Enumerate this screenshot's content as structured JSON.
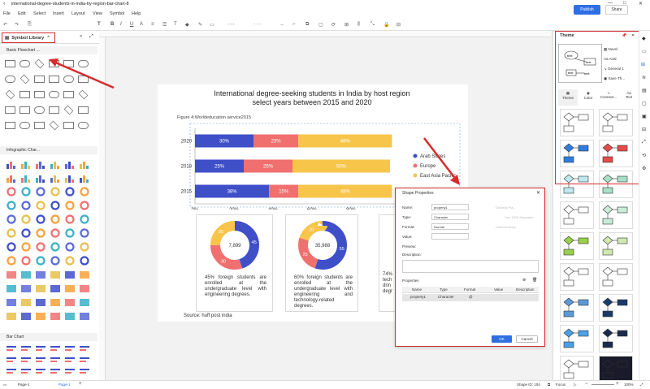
{
  "window": {
    "title": "international-degree-students-in-india-by-region-bar-chart-8"
  },
  "menu": [
    "File",
    "Edit",
    "Select",
    "Insert",
    "Layout",
    "View",
    "Symbol",
    "Help"
  ],
  "toolbar": {
    "publish": "Publish",
    "share": "Share"
  },
  "left_panel": {
    "title": "Symbol Library",
    "sections": [
      "Basic Flowchart ...",
      "Infographic Char...",
      "Bar Chart"
    ]
  },
  "chart": {
    "title_line1": "International degree-seeking students in India by host region",
    "title_line2": "select years between 2015 and 2020",
    "figure_label": "Figure 4:Worldeducation service2015",
    "source": "Source: huff post india"
  },
  "chart_data": {
    "type": "bar",
    "orientation": "horizontal",
    "stacked": true,
    "percent": true,
    "categories": [
      "2020",
      "2018",
      "2015"
    ],
    "series": [
      {
        "name": "Arab States",
        "color": "#3f4fc8",
        "values": [
          30,
          25,
          38
        ]
      },
      {
        "name": "Europe",
        "color": "#f07070",
        "values": [
          23,
          25,
          15
        ]
      },
      {
        "name": "East Asia Pacific",
        "color": "#f7c54a",
        "values": [
          48,
          50,
          48
        ]
      }
    ],
    "labels": [
      [
        "30%",
        "23%",
        "48%"
      ],
      [
        "25%",
        "25%",
        "50%"
      ],
      [
        "38%",
        "15%",
        "48%"
      ]
    ],
    "xticks": [
      "0%",
      "20%",
      "40%",
      "60%",
      "80%"
    ],
    "xlim": [
      0,
      100
    ],
    "legend": "right"
  },
  "donuts": [
    {
      "center": "7,899",
      "segments": [
        45,
        30,
        25
      ],
      "seg_labels": [
        "45",
        "30",
        "25"
      ],
      "text": "45% foreign students are enrolled at the undergraduate level with engineering degrees."
    },
    {
      "center": "35,988",
      "segments": [
        55,
        25,
        20
      ],
      "seg_labels": [
        "55",
        "25",
        "20"
      ],
      "text": "60% foreign students are enrolled at the undergraduate level with engineering and technology-related degrees."
    },
    {
      "text": "74% tech drin degr"
    }
  ],
  "dialog": {
    "title": "Shape Properties",
    "name_label": "Name:",
    "name_value": "property1",
    "type_label": "Type:",
    "type_value": "Character",
    "format_label": "Format:",
    "format_value": "Normal",
    "value_label": "Value:",
    "preview_label": "Preview:",
    "description_label": "Description:",
    "properties_label": "Properties",
    "columns": [
      "Name",
      "Type",
      "Format",
      "Value",
      "Description"
    ],
    "row": [
      "property1",
      "Character",
      "@",
      "",
      ""
    ],
    "ok": "OK",
    "cancel": "Cancel",
    "gray1": "Decimal Pla...",
    "gray2": "Use 1000 Separator",
    "gray3": "Unit/Currency"
  },
  "theme": {
    "title": "Theme",
    "options": [
      "Novel",
      "Arial",
      "General 1",
      "Save Th..."
    ],
    "tabs": [
      "Theme",
      "Color",
      "Connect...",
      "Text"
    ]
  },
  "status": {
    "page_tab": "Page-1",
    "page_label": "Page-1",
    "shape_id": "Shape ID: 104",
    "focus": "Focus",
    "zoom": "100%"
  }
}
